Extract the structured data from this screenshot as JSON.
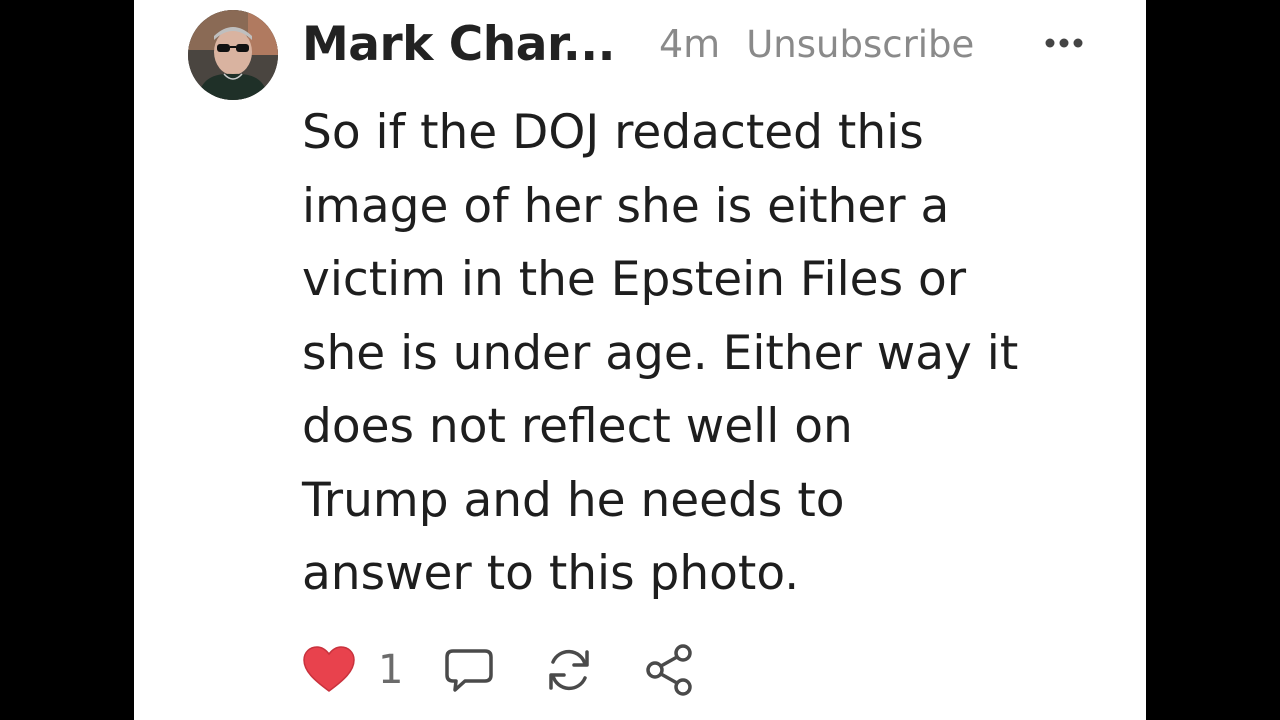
{
  "post": {
    "author": "Mark Char...",
    "time": "4m",
    "unsubscribe_label": "Unsubscribe",
    "body": "So if the DOJ redacted this\nimage of her she is either a\nvictim in the Epstein Files or\nshe is under age. Either way it\ndoes not reflect well on\nTrump and he needs to\nanswer to this photo.",
    "like_count": "1",
    "like_color": "#e8424d"
  },
  "icons": {
    "more": "more-horizontal-icon",
    "like": "heart-icon",
    "comment": "comment-bubble-icon",
    "restack": "restack-icon",
    "share": "share-icon"
  }
}
